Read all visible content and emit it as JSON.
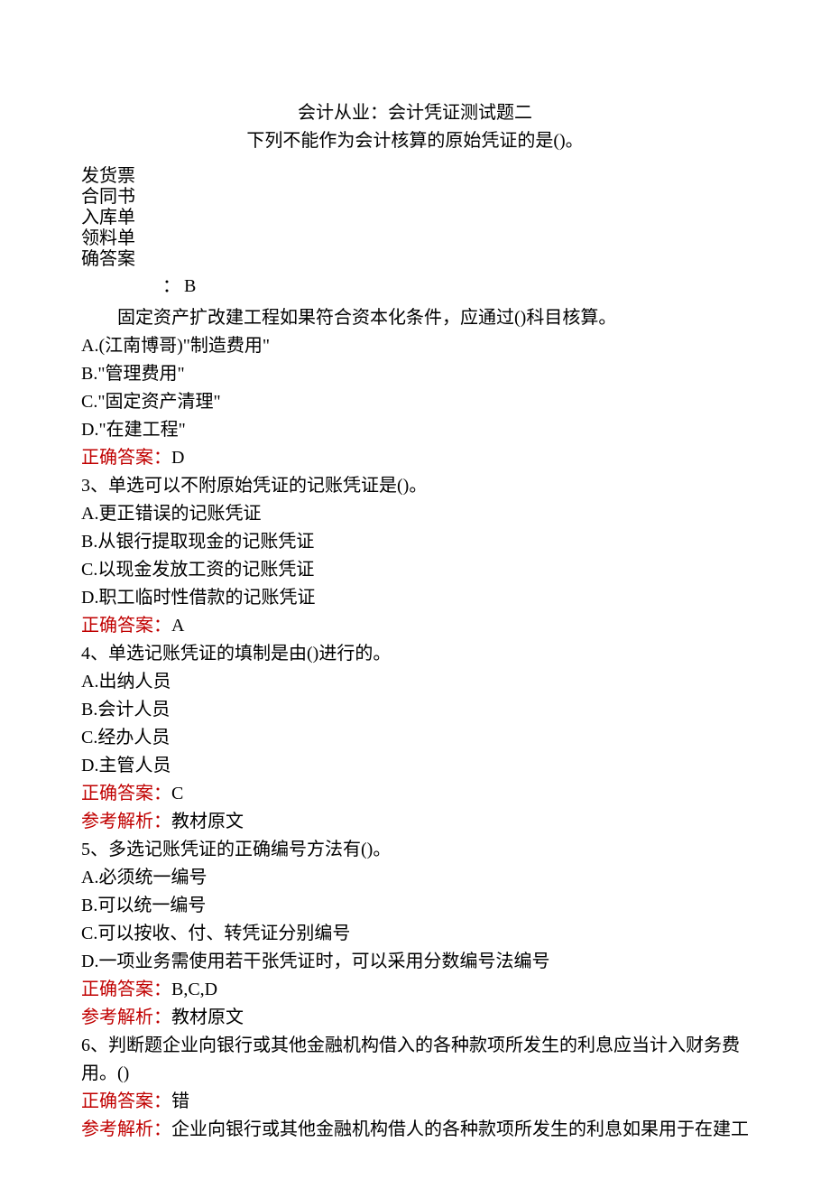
{
  "header": {
    "title1": "会计从业：会计凭证测试题二",
    "title2": "下列不能作为会计核算的原始凭证的是()。"
  },
  "block1": {
    "items": [
      "发货票",
      "合同书",
      "入库单",
      "领料单",
      "确答案"
    ],
    "colon": "：",
    "ans_value": "B"
  },
  "q2_intro": "固定资产扩改建工程如果符合资本化条件，应通过()科目核算。",
  "q2_opts": {
    "a": "A.(江南博哥)\"制造费用\"",
    "b": "B.\"管理费用\"",
    "c": "C.\"固定资产清理\"",
    "d": "D.\"在建工程\""
  },
  "ans_label": "正确答案：",
  "exp_label": "参考解析：",
  "q2_ans": "D",
  "q3_stem": "3、单选可以不附原始凭证的记账凭证是()。",
  "q3_opts": {
    "a": "A.更正错误的记账凭证",
    "b": "B.从银行提取现金的记账凭证",
    "c": "C.以现金发放工资的记账凭证",
    "d": "D.职工临时性借款的记账凭证"
  },
  "q3_ans": "A",
  "q4_stem": "4、单选记账凭证的填制是由()进行的。",
  "q4_opts": {
    "a": "A.出纳人员",
    "b": "B.会计人员",
    "c": "C.经办人员",
    "d": "D.主管人员"
  },
  "q4_ans": "C",
  "q4_exp": "教材原文",
  "q5_stem": "5、多选记账凭证的正确编号方法有()。",
  "q5_opts": {
    "a": "A.必须统一编号",
    "b": "B.可以统一编号",
    "c": "C.可以按收、付、转凭证分别编号",
    "d": "D.一项业务需使用若干张凭证时，可以采用分数编号法编号"
  },
  "q5_ans": "B,C,D",
  "q5_exp": "教材原文",
  "q6_stem": "6、判断题企业向银行或其他金融机构借入的各种款项所发生的利息应当计入财务费用。()",
  "q6_ans": "错",
  "q6_exp": "企业向银行或其他金融机构借人的各种款项所发生的利息如果用于在建工"
}
